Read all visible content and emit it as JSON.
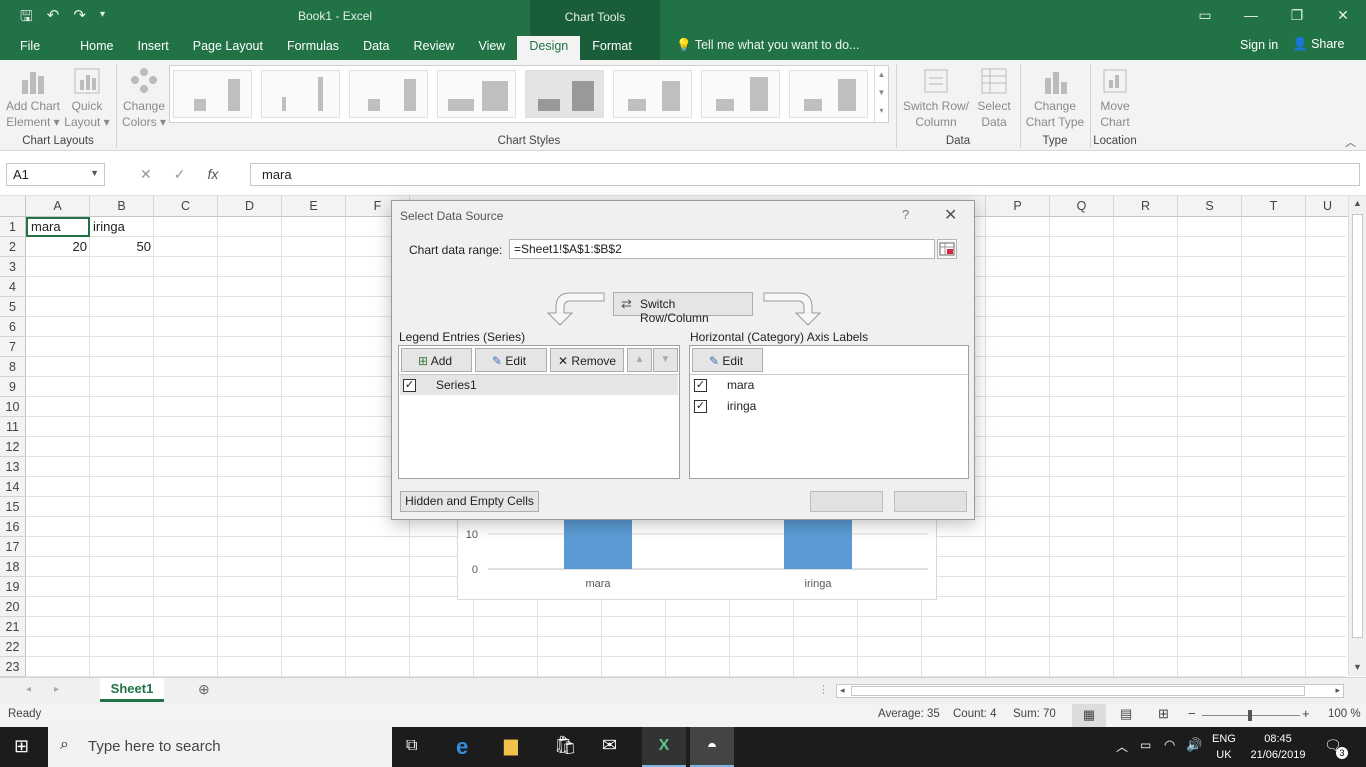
{
  "app": {
    "title": "Book1  -  Excel",
    "context_tab": "Chart Tools"
  },
  "tabs": [
    "File",
    "Home",
    "Insert",
    "Page Layout",
    "Formulas",
    "Data",
    "Review",
    "View",
    "Design",
    "Format"
  ],
  "tell_me": "Tell me what you want to do...",
  "signin": "Sign in",
  "share": "Share",
  "ribbon": {
    "add_chart_element": [
      "Add Chart",
      "Element ▾"
    ],
    "quick_layout": [
      "Quick",
      "Layout ▾"
    ],
    "change_colors": [
      "Change",
      "Colors ▾"
    ],
    "switch_row_column": [
      "Switch Row/",
      "Column"
    ],
    "select_data": [
      "Select",
      "Data"
    ],
    "change_chart_type": [
      "Change",
      "Chart Type"
    ],
    "move_chart": [
      "Move",
      "Chart"
    ],
    "groups": {
      "chart_layouts": "Chart Layouts",
      "chart_styles": "Chart Styles",
      "data": "Data",
      "type": "Type",
      "location": "Location"
    }
  },
  "formula_bar": {
    "name_box": "A1",
    "fx": "fx",
    "value": "mara"
  },
  "columns": [
    "A",
    "B",
    "C",
    "D",
    "E",
    "F",
    "P",
    "Q",
    "R",
    "S",
    "T",
    "U"
  ],
  "rows": [
    "1",
    "2",
    "3",
    "4",
    "5",
    "6",
    "7",
    "8",
    "9",
    "10",
    "11",
    "12",
    "13",
    "14",
    "15",
    "16",
    "17",
    "18",
    "19",
    "20",
    "21",
    "22",
    "23"
  ],
  "cells": {
    "a1": "mara",
    "b1": "iringa",
    "a2": "20",
    "b2": "50"
  },
  "chart_data": {
    "type": "bar",
    "categories": [
      "mara",
      "iringa"
    ],
    "values": [
      20,
      50
    ],
    "visible_ticks": [
      "10",
      "0"
    ]
  },
  "dialog": {
    "title": "Select Data Source",
    "help": "?",
    "range_label": "Chart data range:",
    "range_value": "=Sheet1!$A$1:$B$2",
    "switch_label": "Switch Row/Column",
    "legend_label": "Legend Entries (Series)",
    "legend_buttons": {
      "add": "Add",
      "edit": "Edit",
      "remove": "Remove"
    },
    "series": [
      "Series1"
    ],
    "axis_label": "Horizontal (Category) Axis Labels",
    "axis_edit": "Edit",
    "axis_items": [
      "mara",
      "iringa"
    ],
    "hidden_cells": "Hidden and Empty Cells"
  },
  "sheet_tab": "Sheet1",
  "status": {
    "ready": "Ready",
    "average": "Average: 35",
    "count": "Count: 4",
    "sum": "Sum: 70",
    "zoom": "100 %"
  },
  "taskbar": {
    "search": "Type here to search",
    "lang": "ENG",
    "region": "UK",
    "time": "08:45",
    "date": "21/06/2019",
    "notifications": "3"
  }
}
